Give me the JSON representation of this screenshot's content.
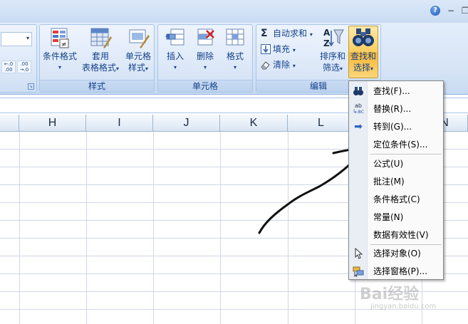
{
  "window": {
    "help": "?",
    "minimize": "−",
    "restore": "❐"
  },
  "ribbon": {
    "number_group": {
      "title": "",
      "dec_increase": "←.0\n.00",
      "dec_decrease": ".00\n→.0"
    },
    "style_group": {
      "title": "样式",
      "conditional_format": "条件格式",
      "table_format": "套用",
      "table_format2": "表格格式",
      "cell_style": "单元格",
      "cell_style2": "样式"
    },
    "cells_group": {
      "title": "单元格",
      "insert": "插入",
      "delete": "删除",
      "format": "格式"
    },
    "edit_group": {
      "title": "编辑",
      "autosum": "自动求和",
      "fill": "填充",
      "clear": "清除",
      "sort_filter": "排序和",
      "sort_filter2": "筛选",
      "find_select": "查找和",
      "find_select2": "选择"
    }
  },
  "columns": [
    "H",
    "I",
    "J",
    "K",
    "L",
    "N"
  ],
  "menu": {
    "items": [
      {
        "label": "查找(F)...",
        "icon": "binoculars-icon"
      },
      {
        "label": "替换(R)...",
        "icon": "replace-icon"
      },
      {
        "label": "转到(G)...",
        "icon": "arrow-right-icon"
      },
      {
        "label": "定位条件(S)...",
        "icon": ""
      },
      {
        "label": "公式(U)",
        "icon": ""
      },
      {
        "label": "批注(M)",
        "icon": ""
      },
      {
        "label": "条件格式(C)",
        "icon": ""
      },
      {
        "label": "常量(N)",
        "icon": ""
      },
      {
        "label": "数据有效性(V)",
        "icon": ""
      },
      {
        "label": "选择对象(O)",
        "icon": "pointer-icon"
      },
      {
        "label": "选择窗格(P)...",
        "icon": "selection-pane-icon"
      }
    ]
  },
  "watermark": {
    "brand": "Bai经验",
    "url": "jingyan.baidu.com"
  }
}
